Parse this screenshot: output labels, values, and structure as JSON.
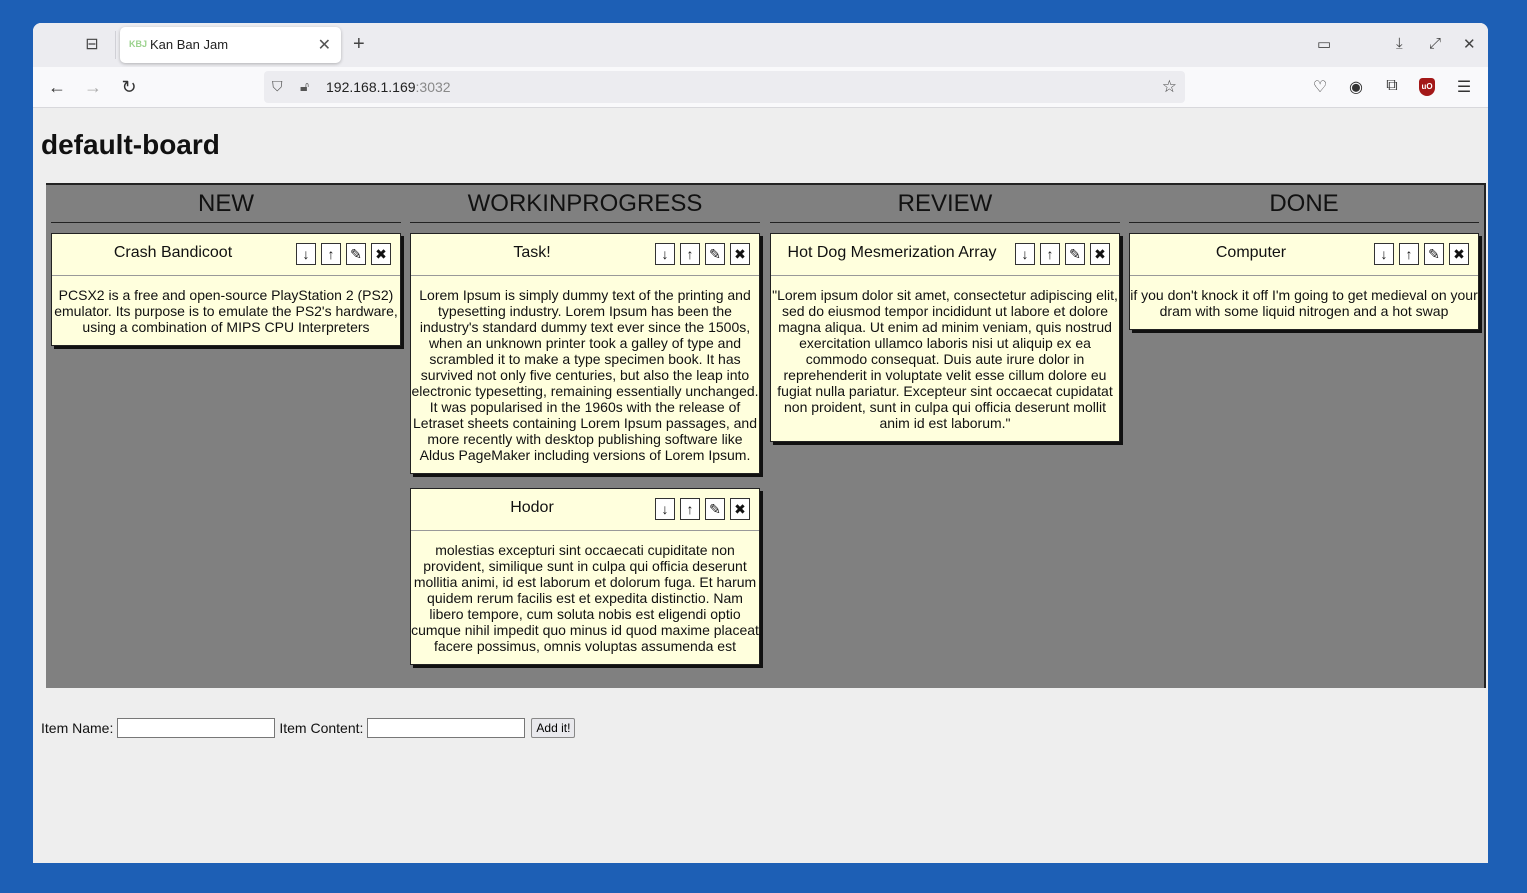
{
  "browser": {
    "tab_title": "Kan Ban Jam",
    "tab_favicon_text": "KBJ",
    "url_host": "192.168.1.169",
    "url_port": ":3032"
  },
  "board": {
    "title": "default-board",
    "columns": [
      {
        "name": "NEW",
        "cards": [
          {
            "title": "Crash Bandicoot",
            "content": "PCSX2 is a free and open-source PlayStation 2 (PS2) emulator. Its purpose is to emulate the PS2's hardware, using a combination of MIPS CPU Interpreters"
          }
        ]
      },
      {
        "name": "WORKINPROGRESS",
        "cards": [
          {
            "title": "Task!",
            "content": "Lorem Ipsum is simply dummy text of the printing and typesetting industry. Lorem Ipsum has been the industry's standard dummy text ever since the 1500s, when an unknown printer took a galley of type and scrambled it to make a type specimen book. It has survived not only five centuries, but also the leap into electronic typesetting, remaining essentially unchanged. It was popularised in the 1960s with the release of Letraset sheets containing Lorem Ipsum passages, and more recently with desktop publishing software like Aldus PageMaker including versions of Lorem Ipsum."
          },
          {
            "title": "Hodor",
            "content": "molestias excepturi sint occaecati cupiditate non provident, similique sunt in culpa qui officia deserunt mollitia animi, id est laborum et dolorum fuga. Et harum quidem rerum facilis est et expedita distinctio. Nam libero tempore, cum soluta nobis est eligendi optio cumque nihil impedit quo minus id quod maxime placeat facere possimus, omnis voluptas assumenda est"
          }
        ]
      },
      {
        "name": "REVIEW",
        "cards": [
          {
            "title": "Hot Dog Mesmerization Array",
            "content": "\"Lorem ipsum dolor sit amet, consectetur adipiscing elit, sed do eiusmod tempor incididunt ut labore et dolore magna aliqua. Ut enim ad minim veniam, quis nostrud exercitation ullamco laboris nisi ut aliquip ex ea commodo consequat. Duis aute irure dolor in reprehenderit in voluptate velit esse cillum dolore eu fugiat nulla pariatur. Excepteur sint occaecat cupidatat non proident, sunt in culpa qui officia deserunt mollit anim id est laborum.\""
          }
        ]
      },
      {
        "name": "DONE",
        "cards": [
          {
            "title": "Computer",
            "content": "if you don't knock it off I'm going to get medieval on your dram with some liquid nitrogen and a hot swap"
          }
        ]
      }
    ],
    "card_buttons": {
      "down": "↓",
      "up": "↑",
      "edit": "✎",
      "delete": "✖"
    }
  },
  "form": {
    "name_label": "Item Name:",
    "name_value": "",
    "content_label": "Item Content:",
    "content_value": "",
    "add_label": "Add it!"
  }
}
